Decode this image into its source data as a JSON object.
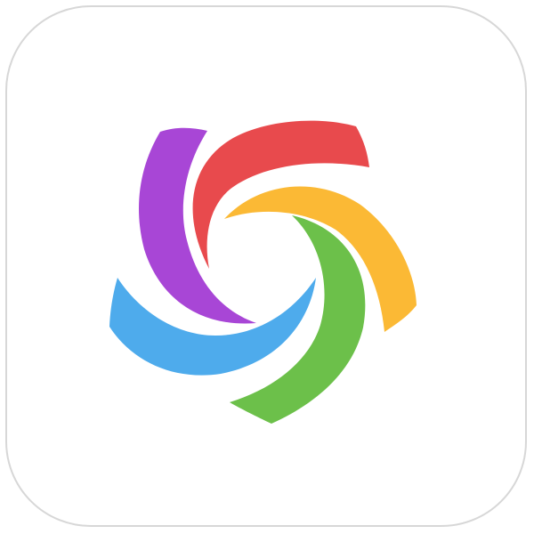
{
  "app_icon": {
    "icon": "pinwheel-swirl-logo",
    "tile_background": "#ffffff",
    "tile_border": "#d7d7d7",
    "petal_colors": {
      "red": "#e84a4d",
      "yellow": "#fbb935",
      "green": "#6cc04a",
      "blue": "#4eabec",
      "purple": "#a846d6"
    }
  }
}
